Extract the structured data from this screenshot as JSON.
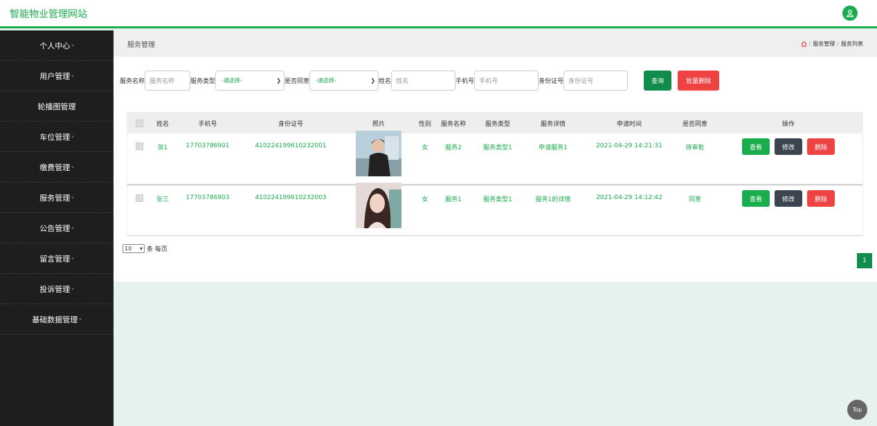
{
  "app": {
    "title": "智能物业管理网站"
  },
  "sidebar": {
    "items": [
      {
        "label": "个人中心"
      },
      {
        "label": "用户管理"
      },
      {
        "label": "轮播图管理"
      },
      {
        "label": "车位管理"
      },
      {
        "label": "缴费管理"
      },
      {
        "label": "服务管理"
      },
      {
        "label": "公告管理"
      },
      {
        "label": "留言管理"
      },
      {
        "label": "投诉管理"
      },
      {
        "label": "基础数据管理"
      }
    ],
    "caret": "▾"
  },
  "page": {
    "title": "服务管理",
    "breadcrumb": [
      "服务管理",
      "服务列表"
    ],
    "sep": "/"
  },
  "filters": {
    "service_name_label": "服务名称",
    "service_name_placeholder": "服务名称",
    "service_type_label": "服务类型",
    "service_type_value": "-请选择-",
    "agree_label": "是否同意",
    "agree_value": "-请选择-",
    "name_label": "姓名",
    "name_placeholder": "姓名",
    "phone_label": "手机号",
    "phone_placeholder": "手机号",
    "idcard_label": "身份证号",
    "idcard_placeholder": "身份证号",
    "search_button": "查询",
    "batch_delete_button": "批量删除"
  },
  "table": {
    "headers": [
      "姓名",
      "手机号",
      "身份证号",
      "照片",
      "性别",
      "服务名称",
      "服务类型",
      "服务详情",
      "申请时间",
      "是否同意",
      "操作"
    ],
    "rows": [
      {
        "name": "张1",
        "phone": "17703786901",
        "idcard": "410224199610232001",
        "sex": "女",
        "service": "服务2",
        "type": "服务类型1",
        "detail": "申请服务1",
        "time": "2021-04-29 14:21:31",
        "agree": "待审批"
      },
      {
        "name": "张三",
        "phone": "17703786903",
        "idcard": "410224199610232003",
        "sex": "女",
        "service": "服务1",
        "type": "服务类型1",
        "detail": "服务1的详情",
        "time": "2021-04-29 14:12:42",
        "agree": "同意"
      }
    ],
    "actions": {
      "view": "查看",
      "edit": "修改",
      "delete": "删除"
    }
  },
  "pagination": {
    "page_size": "10",
    "page_size_suffix": "条 每页",
    "current_page": "1"
  },
  "back_to_top": "Top",
  "colors": {
    "accent": "#1aad4e",
    "danger": "#ef4343",
    "dark": "#3c4450",
    "sidebar": "#1e1e1e"
  }
}
